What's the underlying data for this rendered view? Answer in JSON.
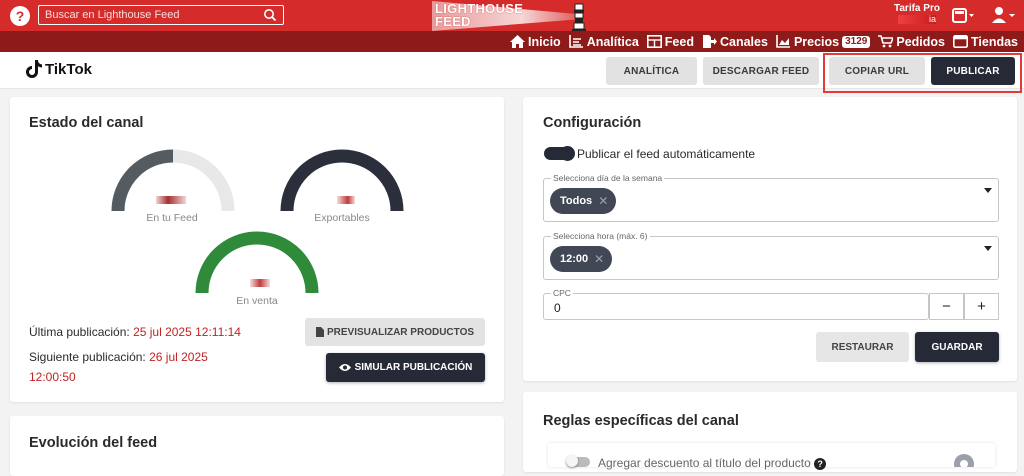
{
  "topbar": {
    "help_label": "?",
    "search_placeholder": "Buscar en Lighthouse Feed",
    "logo_line1": "LIGHTHOUSE",
    "logo_line2": "FEED",
    "plan_label": "Tarifa Pro",
    "plan_sub": "ia"
  },
  "nav": {
    "items": [
      {
        "label": "Inicio",
        "icon": "home-icon"
      },
      {
        "label": "Analítica",
        "icon": "analytics-icon"
      },
      {
        "label": "Feed",
        "icon": "feed-icon"
      },
      {
        "label": "Canales",
        "icon": "channels-icon"
      },
      {
        "label": "Precios",
        "icon": "prices-icon",
        "badge": "3129"
      },
      {
        "label": "Pedidos",
        "icon": "cart-icon"
      },
      {
        "label": "Tiendas",
        "icon": "store-icon"
      }
    ]
  },
  "header": {
    "channel_name": "TikTok",
    "buttons": {
      "analytics": "ANALÍTICA",
      "download": "DESCARGAR FEED",
      "copy_url": "COPIAR URL",
      "publish": "PUBLICAR"
    }
  },
  "status": {
    "title": "Estado del canal",
    "gauges": {
      "feed_label": "En tu Feed",
      "exportable_label": "Exportables",
      "on_sale_label": "En venta"
    },
    "last_pub_label": "Última publicación:",
    "last_pub_value": "25 jul 2025 12:11:14",
    "next_pub_label": "Siguiente publicación:",
    "next_pub_value_line1": "26 jul 2025",
    "next_pub_value_line2": "12:00:50",
    "preview_button": "PREVISUALIZAR PRODUCTOS",
    "simulate_button": "SIMULAR PUBLICACIÓN"
  },
  "evolution": {
    "title": "Evolución del feed"
  },
  "config": {
    "title": "Configuración",
    "auto_publish_label": "Publicar el feed automáticamente",
    "day_legend": "Selecciona día de la semana",
    "day_chip": "Todos",
    "hour_legend": "Selecciona hora (máx. 6)",
    "hour_chip": "12:00",
    "cpc_legend": "CPC",
    "cpc_value": "0",
    "minus": "−",
    "plus": "+",
    "reset_button": "RESTAURAR",
    "save_button": "GUARDAR"
  },
  "rules": {
    "title": "Reglas específicas del canal",
    "first_rule": "Agregar descuento al título del producto",
    "help_mark": "?"
  },
  "colors": {
    "brand_red": "#d52b2b",
    "nav_dark_red": "#8f1a1a",
    "dark_button": "#262a36",
    "gauge_grey": "#545b61",
    "gauge_dark": "#2b2f3c",
    "gauge_green": "#2f8a3a",
    "date_red": "#c02323"
  }
}
